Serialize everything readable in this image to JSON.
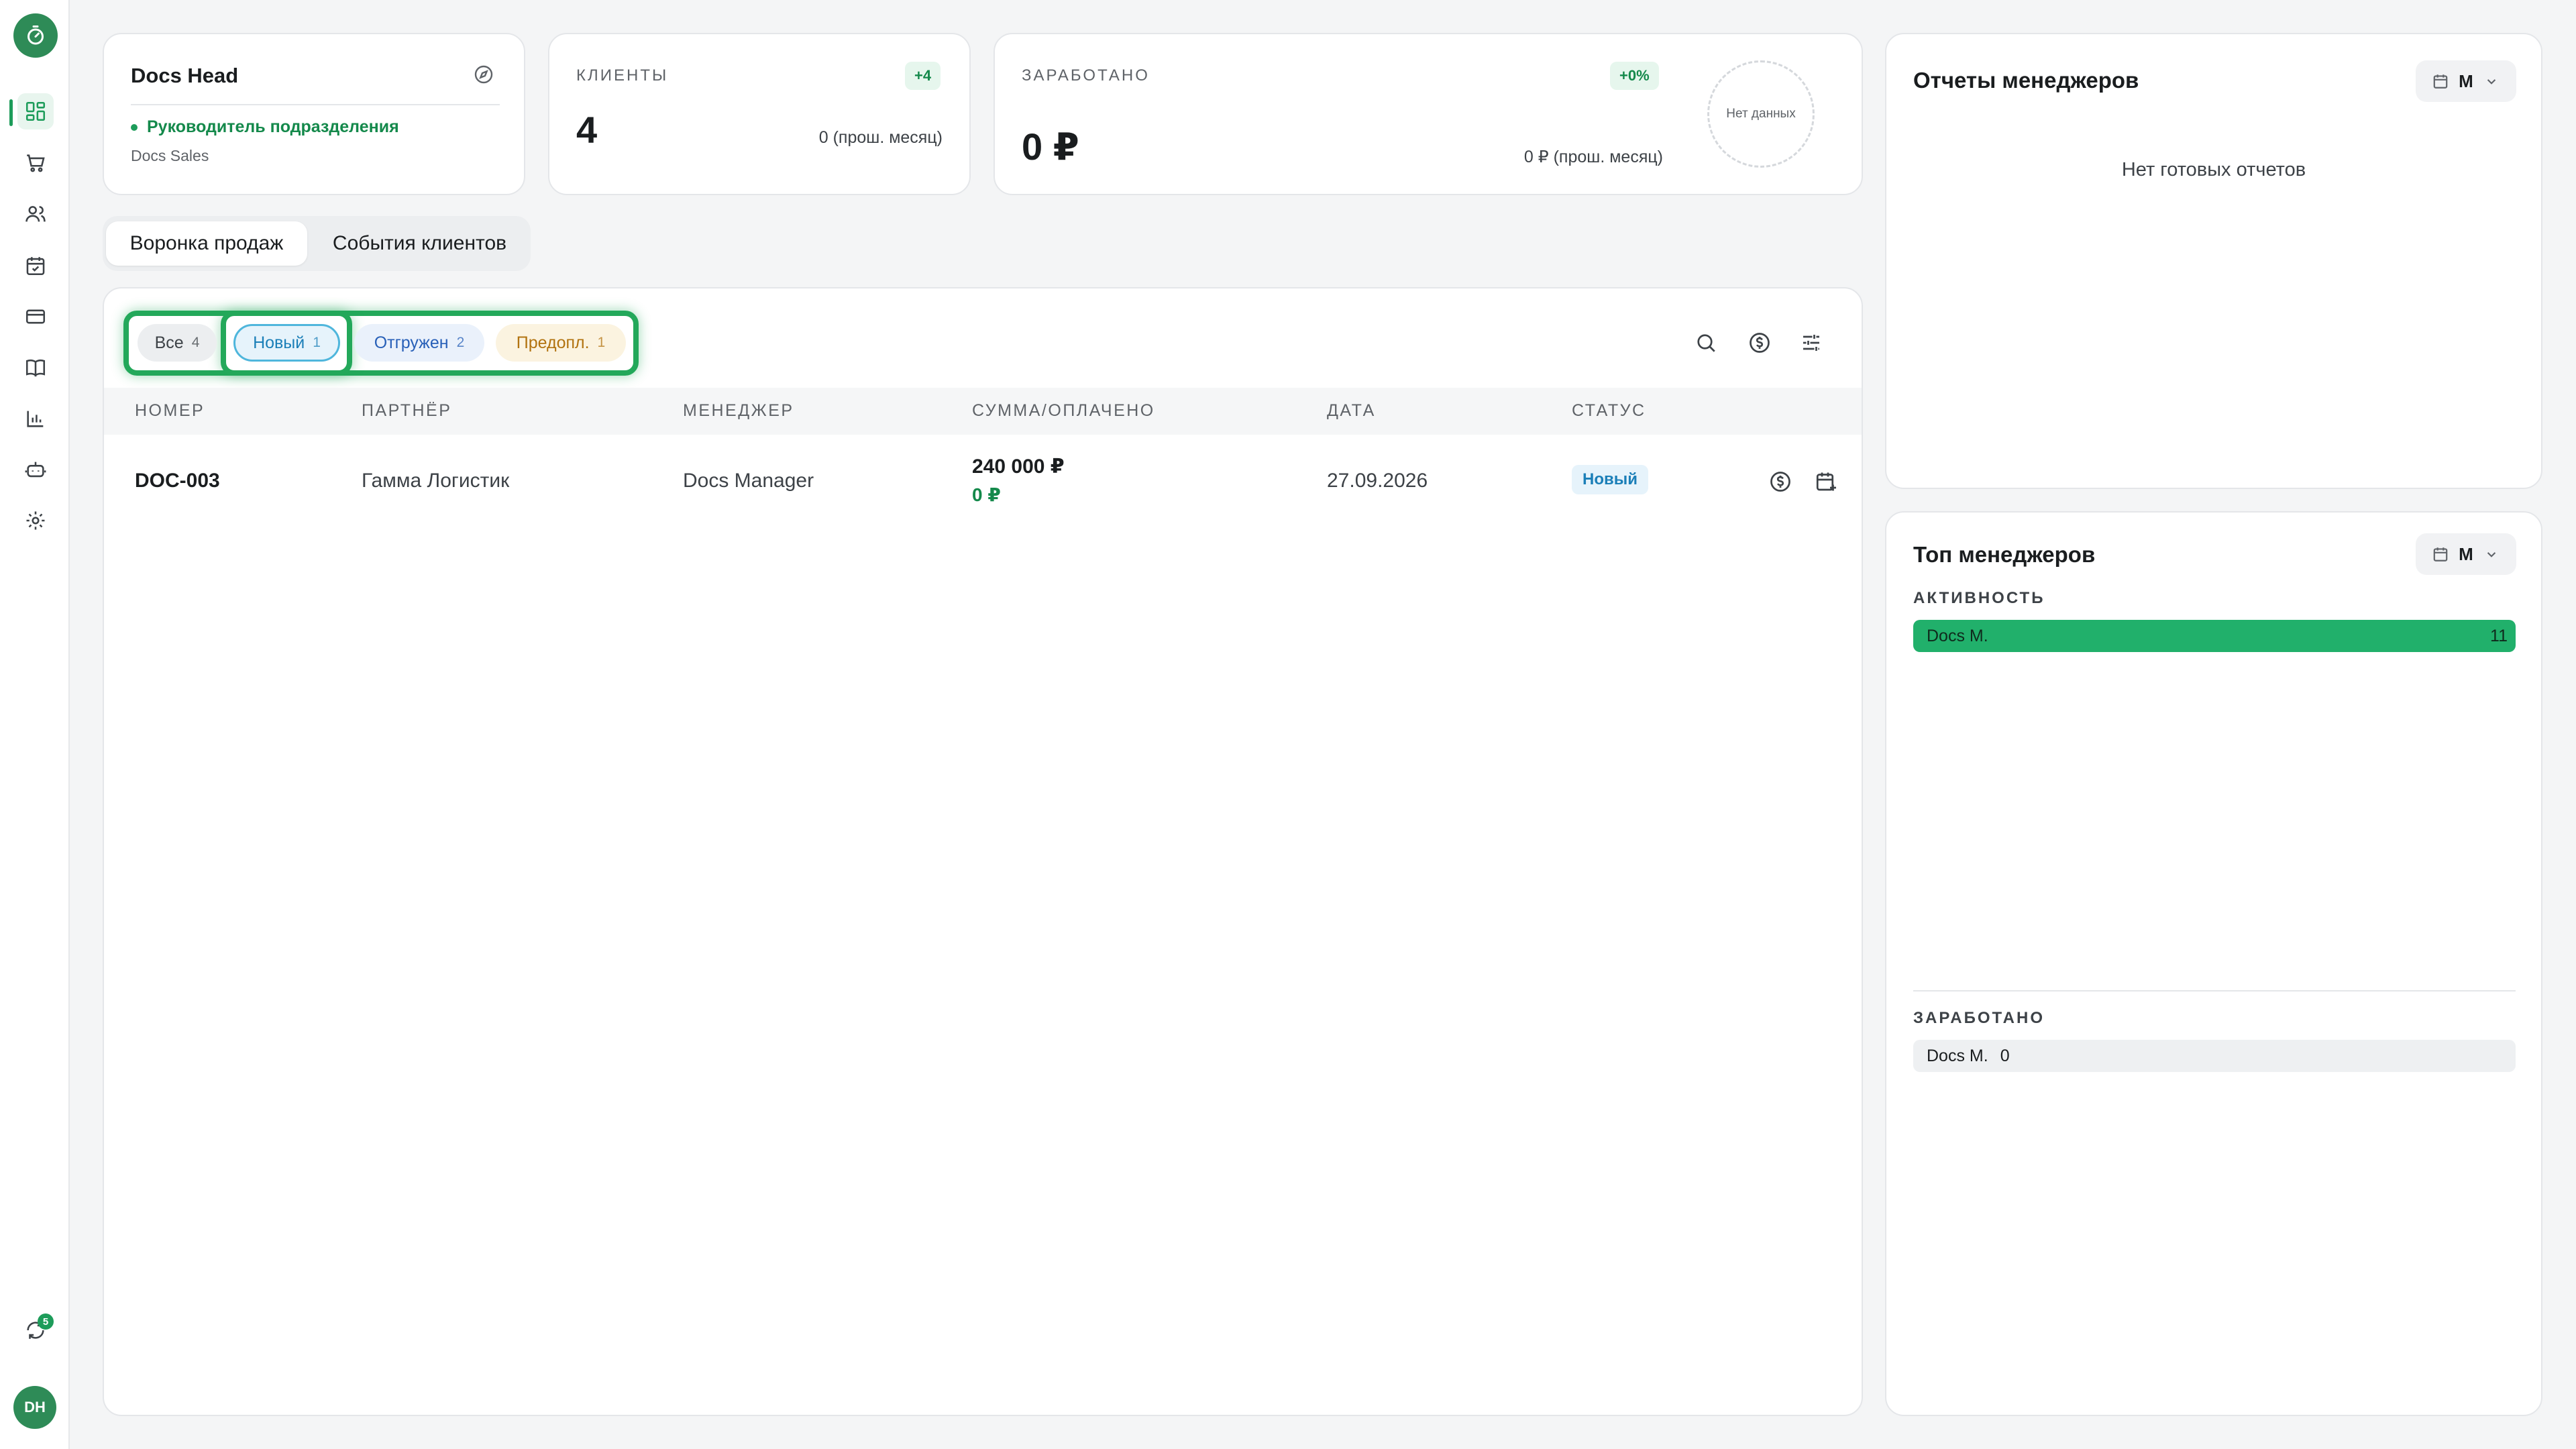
{
  "sidebar": {
    "logo_icon": "stopwatch-icon",
    "nav": [
      "dashboard-icon",
      "cart-icon",
      "users-icon",
      "calendar-icon",
      "card-icon",
      "book-icon",
      "chart-icon",
      "robot-icon",
      "settings-icon"
    ],
    "sync_badge": "5",
    "avatar_initials": "DH"
  },
  "profile": {
    "name": "Docs Head",
    "role": "Руководитель подразделения",
    "department": "Docs Sales"
  },
  "clients": {
    "label": "КЛИЕНТЫ",
    "delta": "+4",
    "value": "4",
    "previous": "0 (прош. месяц)"
  },
  "earned": {
    "label": "ЗАРАБОТАНО",
    "delta": "+0%",
    "value": "0 ₽",
    "previous": "0 ₽ (прош. месяц)",
    "no_data": "Нет данных"
  },
  "tabs": [
    {
      "label": "Воронка продаж"
    },
    {
      "label": "События клиентов"
    }
  ],
  "filters": [
    {
      "label": "Все",
      "count": "4"
    },
    {
      "label": "Новый",
      "count": "1"
    },
    {
      "label": "Отгружен",
      "count": "2"
    },
    {
      "label": "Предопл.",
      "count": "1"
    }
  ],
  "table": {
    "headers": [
      "НОМЕР",
      "ПАРТНЁР",
      "МЕНЕДЖЕР",
      "СУММА/ОПЛАЧЕНО",
      "ДАТА",
      "СТАТУС"
    ],
    "rows": [
      {
        "number": "DOC-003",
        "partner": "Гамма Логистик",
        "manager": "Docs Manager",
        "sum": "240 000 ₽",
        "paid": "0 ₽",
        "date": "27.09.2026",
        "status": "Новый"
      }
    ]
  },
  "reports": {
    "title": "Отчеты менеджеров",
    "period": "М",
    "empty": "Нет готовых отчетов"
  },
  "top": {
    "title": "Топ менеджеров",
    "period": "М",
    "activity_label": "АКТИВНОСТЬ",
    "activity": [
      {
        "name": "Docs M.",
        "value": "11",
        "fill": 1.0
      }
    ],
    "earned_label": "ЗАРАБОТАНО",
    "earned": [
      {
        "name": "Docs M.",
        "value": "0"
      }
    ]
  },
  "colors": {
    "accent": "#1d9c5a",
    "status_new_bg": "#e6f3fb",
    "status_new_text": "#1b7fb8"
  }
}
